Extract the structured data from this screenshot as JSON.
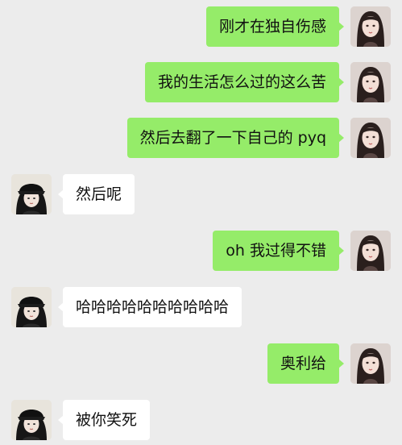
{
  "conversation": {
    "messages": [
      {
        "sender": "me",
        "text": "刚才在独自伤感"
      },
      {
        "sender": "me",
        "text": "我的生活怎么过的这么苦"
      },
      {
        "sender": "me",
        "text": "然后去翻了一下自己的 pyq"
      },
      {
        "sender": "other",
        "text": "然后呢"
      },
      {
        "sender": "me",
        "text": "oh 我过得不错"
      },
      {
        "sender": "other",
        "text": "哈哈哈哈哈哈哈哈哈哈"
      },
      {
        "sender": "me",
        "text": "奥利给"
      },
      {
        "sender": "other",
        "text": "被你笑死"
      }
    ]
  },
  "colors": {
    "background": "#ececec",
    "outgoing_bubble": "#95ec69",
    "incoming_bubble": "#ffffff"
  },
  "icons": {
    "my_avatar": "female-portrait-avatar",
    "friend_avatar": "cap-girl-avatar"
  }
}
